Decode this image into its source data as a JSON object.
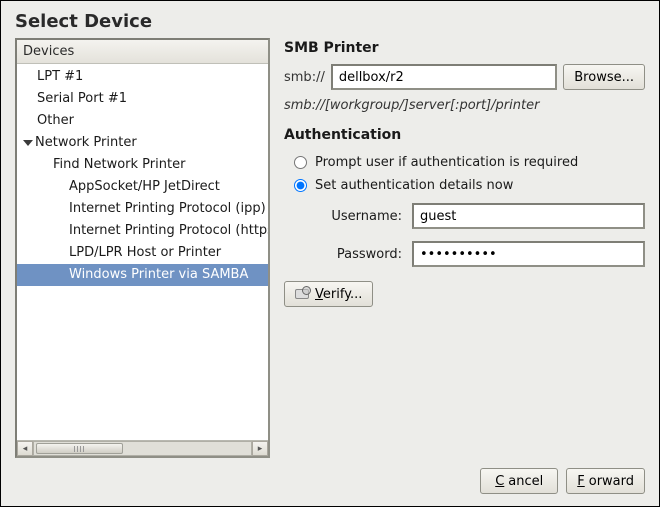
{
  "title": "Select Device",
  "tree": {
    "header": "Devices",
    "lpt": "LPT #1",
    "serial": "Serial Port #1",
    "other": "Other",
    "network_printer": "Network Printer",
    "find": "Find Network Printer",
    "appsocket": "AppSocket/HP JetDirect",
    "ipp": "Internet Printing Protocol (ipp)",
    "ipps": "Internet Printing Protocol (https)",
    "lpd": "LPD/LPR Host or Printer",
    "samba": "Windows Printer via SAMBA"
  },
  "panel": {
    "title": "SMB Printer",
    "smb_prefix": "smb://",
    "smb_value": "dellbox/r2",
    "browse": "Browse...",
    "hint": "smb://[workgroup/]server[:port]/printer",
    "auth_title": "Authentication",
    "opt_prompt": "Prompt user if authentication is required",
    "opt_set_now": "Set authentication details now",
    "username_label": "Username:",
    "username_value": "guest",
    "password_label": "Password:",
    "password_value": "••••••••••",
    "verify": "Verify..."
  },
  "footer": {
    "cancel": "Cancel",
    "forward": "Forward"
  }
}
